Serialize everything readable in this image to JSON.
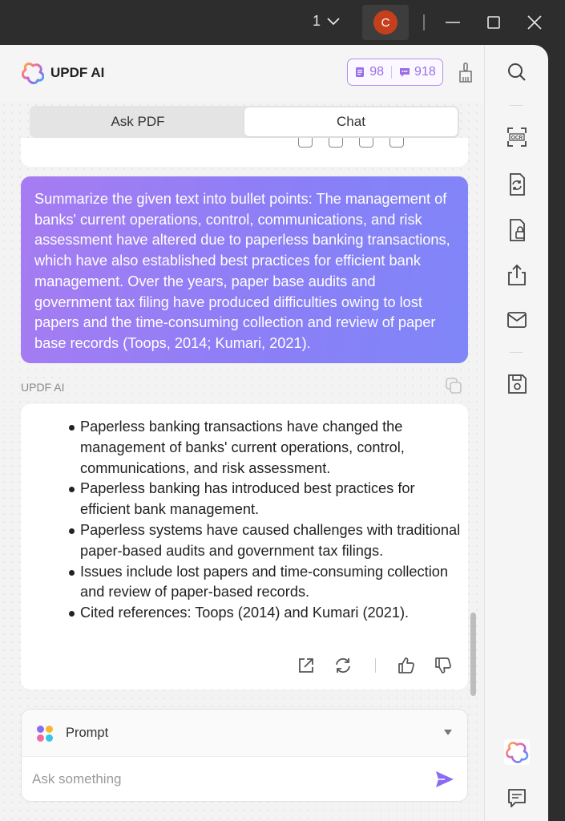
{
  "titlebar": {
    "page_number": "1",
    "avatar_initial": "C"
  },
  "header": {
    "app_name": "UPDF AI",
    "credits_a": "98",
    "credits_b": "918"
  },
  "tabs": [
    {
      "label": "Ask PDF"
    },
    {
      "label": "Chat"
    }
  ],
  "messages": {
    "user_text": "Summarize the given text into bullet points: The management of banks' current operations, control, communications, and risk assessment have altered due to paperless banking transactions, which have also established best practices for efficient bank management. Over the years, paper base audits and government tax filing have produced difficulties owing to lost papers and the time-consuming collection and review of paper base records (Toops, 2014; Kumari, 2021).",
    "ai_label": "UPDF AI",
    "ai_bullets": [
      "Paperless banking transactions have changed the management of banks' current operations, control, communications, and risk assessment.",
      "Paperless banking has introduced best practices for efficient bank management.",
      "Paperless systems have caused challenges with traditional paper-based audits and government tax filings.",
      "Issues include lost papers and time-consuming collection and review of paper-based records.",
      "Cited references: Toops (2014) and Kumari (2021)."
    ]
  },
  "composer": {
    "prompt_label": "Prompt",
    "input_placeholder": "Ask something"
  },
  "colors": {
    "accent": "#9b6fe8",
    "user_bubble_start": "#a77cf2",
    "user_bubble_end": "#7f86f7",
    "avatar": "#c4401c"
  },
  "sidebar_icons": [
    "search-icon",
    "ocr-icon",
    "convert-icon",
    "protect-icon",
    "share-icon",
    "mail-icon",
    "save-icon",
    "updf-ai-icon",
    "comment-icon"
  ]
}
